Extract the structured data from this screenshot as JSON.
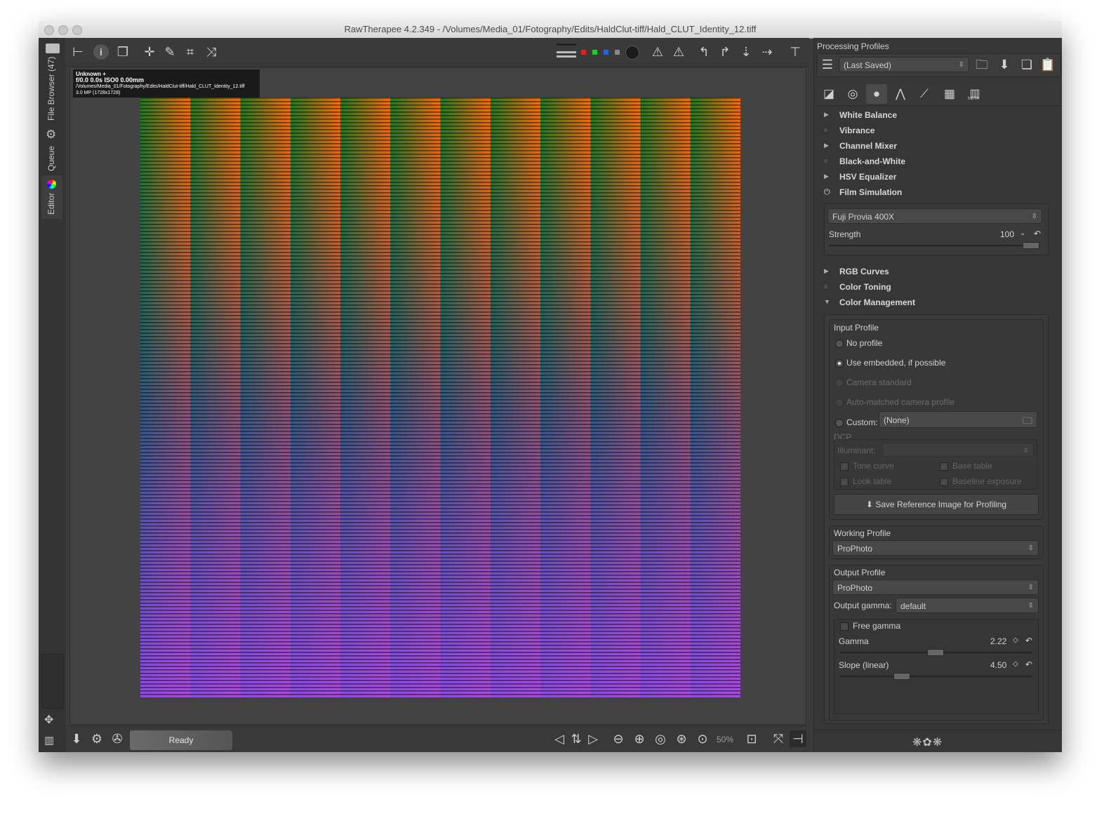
{
  "window": {
    "title": "RawTherapee 4.2.349 - /Volumes/Media_01/Fotography/Edits/HaldClut-tiff/Hald_CLUT_Identity_12.tiff"
  },
  "left_tabs": {
    "file_browser": "File Browser (47)",
    "queue": "Queue",
    "editor": "Editor"
  },
  "info_overlay": {
    "line1": "Unknown +",
    "line2": "f/0.0  0.0s  ISO0  0.00mm",
    "line3": "/Volumes/Media_01/Fotography/Edits/HaldClut-tiff/Hald_CLUT_Identity_12.tiff",
    "line4": "3.0 MP (1728x1728)"
  },
  "status": {
    "ready": "Ready",
    "zoom": "50%"
  },
  "panel": {
    "header": "Processing Profiles",
    "profile_combo": "(Last Saved)",
    "sections_top": [
      "White Balance",
      "Vibrance",
      "Channel Mixer",
      "Black-and-White",
      "HSV Equalizer",
      "Film Simulation"
    ],
    "film_sim": {
      "lut": "Fuji Provia 400X",
      "strength_label": "Strength",
      "strength_value": "100",
      "strength_fraction": 1.0
    },
    "sections_mid": [
      "RGB Curves",
      "Color Toning",
      "Color Management"
    ],
    "input_profile": {
      "title": "Input Profile",
      "options": [
        "No profile",
        "Use embedded, if possible",
        "Camera standard",
        "Auto-matched camera profile"
      ],
      "custom_label": "Custom:",
      "custom_value": "(None)",
      "dcp_title": "DCP",
      "illuminant_label": "Illuminant:",
      "tone_curve": "Tone curve",
      "base_table": "Base table",
      "look_table": "Look table",
      "baseline_exposure": "Baseline exposure",
      "save_ref": "Save Reference Image for Profiling"
    },
    "working_profile": {
      "title": "Working Profile",
      "value": "ProPhoto"
    },
    "output_profile": {
      "title": "Output Profile",
      "value": "ProPhoto",
      "gamma_label": "Output gamma:",
      "gamma_value": "default",
      "free_gamma": "Free gamma",
      "gamma": {
        "label": "Gamma",
        "value": "2.22"
      },
      "slope": {
        "label": "Slope (linear)",
        "value": "4.50"
      }
    },
    "tab_meta": "META"
  }
}
